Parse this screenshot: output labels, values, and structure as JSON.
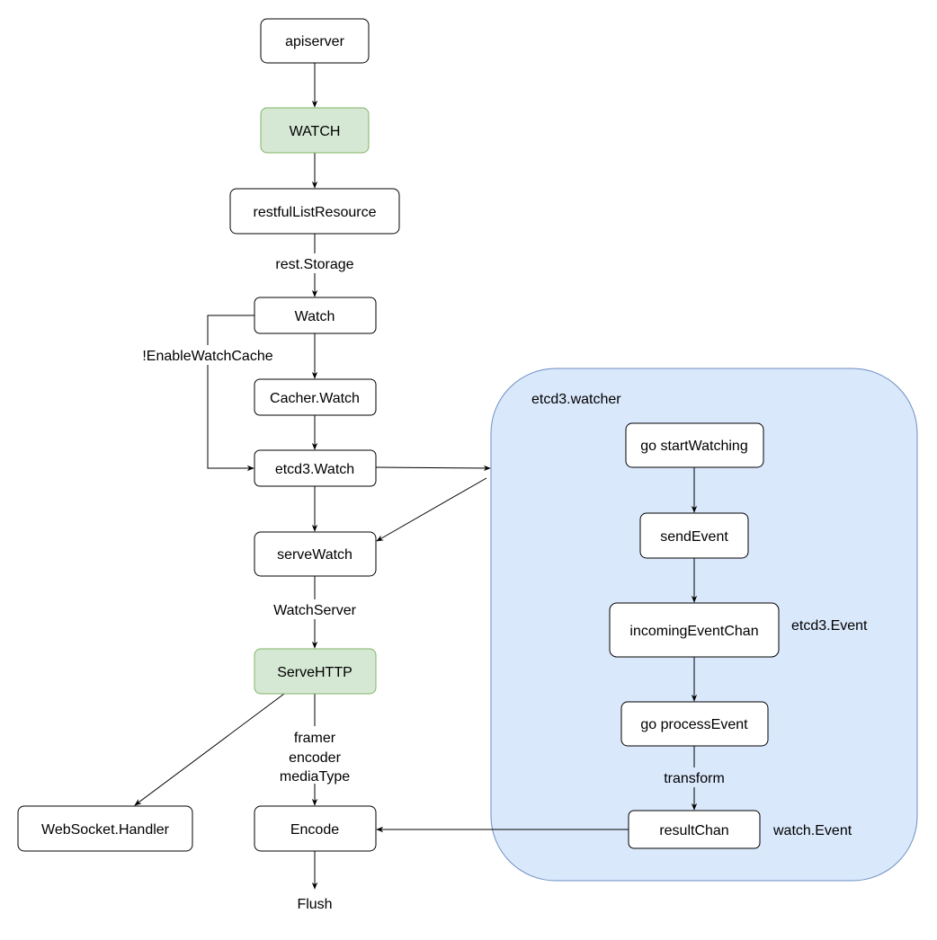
{
  "nodes": {
    "apiserver": "apiserver",
    "watch_verb": "WATCH",
    "restful": "restfulListResource",
    "watch": "Watch",
    "cacher_watch": "Cacher.Watch",
    "etcd3_watch": "etcd3.Watch",
    "serve_watch": "serveWatch",
    "serve_http": "ServeHTTP",
    "websocket": "WebSocket.Handler",
    "encode": "Encode",
    "start_watching": "go startWatching",
    "send_event": "sendEvent",
    "incoming": "incomingEventChan",
    "process_event": "go processEvent",
    "result_chan": "resultChan"
  },
  "labels": {
    "rest_storage": "rest.Storage",
    "enable_watch_cache": "!EnableWatchCache",
    "watch_server": "WatchServer",
    "framer": "framer",
    "encoder": "encoder",
    "media_type": "mediaType",
    "flush": "Flush",
    "etcd3_watcher": "etcd3.watcher",
    "etcd3_event": "etcd3.Event",
    "transform": "transform",
    "watch_event": "watch.Event"
  },
  "colors": {
    "green_fill": "#d5e8d4",
    "green_stroke": "#82b366",
    "container_fill": "#dae8fc",
    "container_stroke": "#6c8ebf"
  }
}
